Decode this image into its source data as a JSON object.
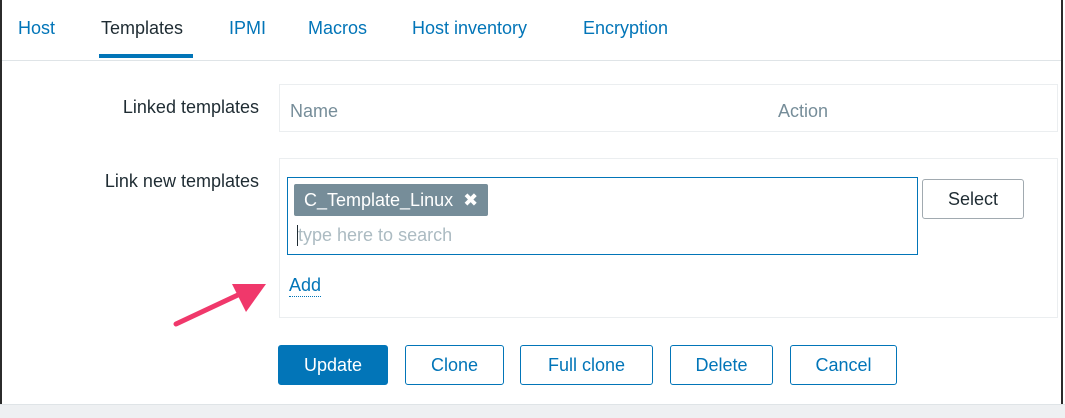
{
  "tabs": [
    {
      "label": "Host"
    },
    {
      "label": "Templates"
    },
    {
      "label": "IPMI"
    },
    {
      "label": "Macros"
    },
    {
      "label": "Host inventory"
    },
    {
      "label": "Encryption"
    }
  ],
  "active_tab": "Templates",
  "linked_templates": {
    "label": "Linked templates",
    "col_name": "Name",
    "col_action": "Action"
  },
  "link_new": {
    "label": "Link new templates",
    "selected_chip": "C_Template_Linux",
    "chip_remove_glyph": "✖",
    "search_placeholder": "type here to search",
    "search_value": "",
    "select_button": "Select",
    "add_link": "Add"
  },
  "actions": {
    "update": "Update",
    "clone": "Clone",
    "full_clone": "Full clone",
    "delete": "Delete",
    "cancel": "Cancel"
  },
  "colors": {
    "accent": "#0275b8",
    "annotation_arrow": "#f0386b"
  },
  "icons": {
    "chip_remove": "close-icon",
    "annotation": "pointer-arrow-icon"
  }
}
